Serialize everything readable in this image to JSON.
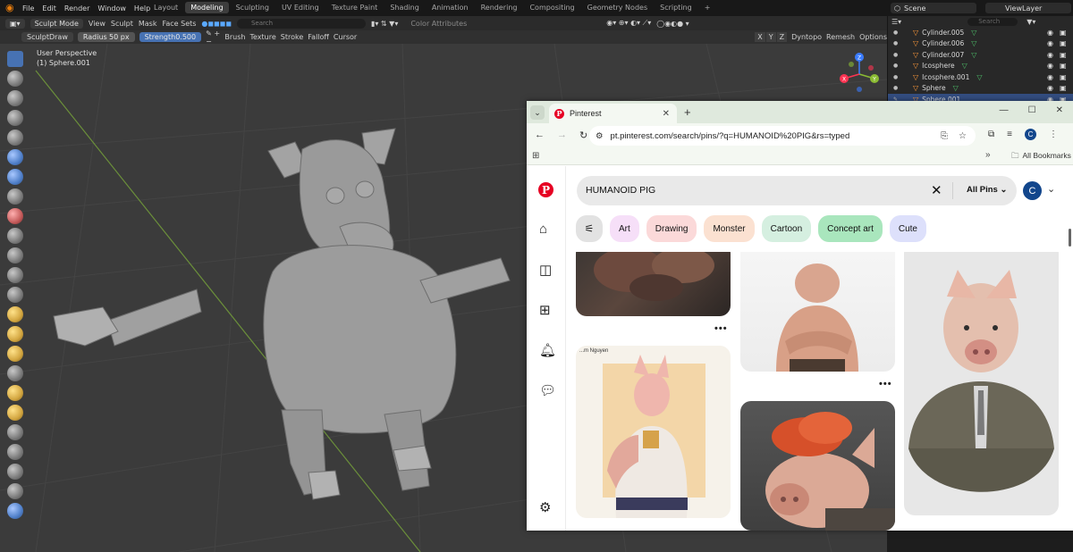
{
  "blender": {
    "menu": [
      "File",
      "Edit",
      "Render",
      "Window",
      "Help"
    ],
    "workspaces": [
      {
        "label": "Layout",
        "active": false
      },
      {
        "label": "Modeling",
        "active": true
      },
      {
        "label": "Sculpting",
        "active": false
      },
      {
        "label": "UV Editing",
        "active": false
      },
      {
        "label": "Texture Paint",
        "active": false
      },
      {
        "label": "Shading",
        "active": false
      },
      {
        "label": "Animation",
        "active": false
      },
      {
        "label": "Rendering",
        "active": false
      },
      {
        "label": "Compositing",
        "active": false
      },
      {
        "label": "Geometry Nodes",
        "active": false
      },
      {
        "label": "Scripting",
        "active": false
      }
    ],
    "add_workspace": "+",
    "scene": "Scene",
    "view_layer": "ViewLayer",
    "header": {
      "mode": "Sculpt Mode",
      "view": "View",
      "sculpt": "Sculpt",
      "mask": "Mask",
      "face_sets": "Face Sets",
      "search_placeholder": "Search",
      "color_attributes": "Color Attributes"
    },
    "tool": {
      "brush_name": "SculptDraw",
      "radius_label": "Radius",
      "radius_value": "50 px",
      "strength_label": "Strength",
      "strength_value": "0.500",
      "brush": "Brush",
      "texture": "Texture",
      "stroke": "Stroke",
      "falloff": "Falloff",
      "cursor": "Cursor",
      "axis_x": "X",
      "axis_y": "Y",
      "axis_z": "Z",
      "dyntopo": "Dyntopo",
      "remesh": "Remesh",
      "options": "Options"
    },
    "viewport": {
      "perspective": "User Perspective",
      "object": "(1) Sphere.001"
    },
    "gizmo": {
      "x": "X",
      "y": "Y",
      "z": "Z"
    },
    "outliner": {
      "search_placeholder": "Search",
      "rows": [
        {
          "name": "Cylinder.005",
          "selected": false
        },
        {
          "name": "Cylinder.006",
          "selected": false
        },
        {
          "name": "Cylinder.007",
          "selected": false
        },
        {
          "name": "Icosphere",
          "selected": false
        },
        {
          "name": "Icosphere.001",
          "selected": false
        },
        {
          "name": "Sphere",
          "selected": false
        },
        {
          "name": "Sphere.001",
          "selected": true
        }
      ]
    },
    "colors": {
      "accent": "#4772b3",
      "active_tab": "#3d3d3d",
      "viewport_bg": "#3b3b3b"
    }
  },
  "chrome": {
    "tab_title": "Pinterest",
    "url": "pt.pinterest.com/search/pins/?q=HUMANOID%20PIG&rs=typed",
    "all_bookmarks": "All Bookmarks",
    "profile_initial": "C"
  },
  "pinterest": {
    "search_query": "HUMANOID PIG",
    "scope": "All Pins",
    "avatar_initial": "C",
    "filters": [
      {
        "label": "Art",
        "color": "#f6dff8"
      },
      {
        "label": "Drawing",
        "color": "#fbd9d9"
      },
      {
        "label": "Monster",
        "color": "#fbe1d1"
      },
      {
        "label": "Cartoon",
        "color": "#d5efe0"
      },
      {
        "label": "Concept art",
        "color": "#a9e6bd"
      },
      {
        "label": "Cute",
        "color": "#dde0fb"
      }
    ],
    "pins": [
      {
        "id": "pin-pig-creature-dark"
      },
      {
        "id": "pin-shirtless-pig-man"
      },
      {
        "id": "pin-pig-in-suit"
      },
      {
        "id": "pin-tattooed-pig-illustration",
        "caption": "...m Nguyen"
      },
      {
        "id": "pin-red-haired-pig"
      }
    ],
    "more_dots": "•••",
    "brand_color": "#e60023"
  }
}
